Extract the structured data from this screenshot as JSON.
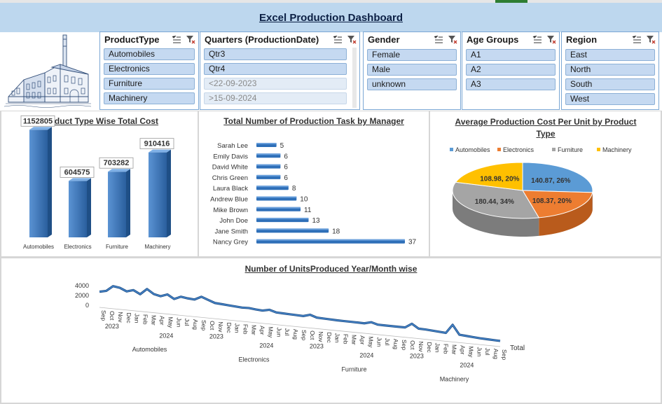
{
  "dashboard_title": "Excel Production Dashboard",
  "slicers": {
    "product_type": {
      "title": "ProductType",
      "items": [
        "Automobiles",
        "Electronics",
        "Furniture",
        "Machinery"
      ]
    },
    "quarters": {
      "title": "Quarters (ProductionDate)",
      "items": [
        "Qtr3",
        "Qtr4"
      ],
      "dim_items": [
        "<22-09-2023",
        ">15-09-2024"
      ]
    },
    "gender": {
      "title": "Gender",
      "items": [
        "Female",
        "Male",
        "unknown"
      ]
    },
    "age_groups": {
      "title": "Age Groups",
      "items": [
        "A1",
        "A2",
        "A3"
      ]
    },
    "region": {
      "title": "Region",
      "items": [
        "East",
        "North",
        "South",
        "West"
      ]
    }
  },
  "charts": {
    "product_cost": {
      "title": "Product Type Wise Total Cost"
    },
    "manager_tasks": {
      "title": "Total Number of Production Task by Manager"
    },
    "avg_cost": {
      "title": "Average Production Cost Per Unit by Product Type"
    },
    "units": {
      "title": "Number of UnitsProduced Year/Month wise",
      "legend": "Total"
    }
  },
  "colors": {
    "bar_blue": "#2e6fb8",
    "header_blue": "#bdd7ee",
    "automobiles": "#5b9bd5",
    "electronics": "#ed7d31",
    "furniture": "#a5a5a5",
    "machinery": "#ffc000"
  },
  "chart_data": [
    {
      "type": "bar",
      "title": "Product Type Wise Total Cost",
      "categories": [
        "Automobiles",
        "Electronics",
        "Furniture",
        "Machinery"
      ],
      "values": [
        1152805,
        604575,
        703282,
        910416
      ],
      "data_labels": [
        "1152805",
        "604575",
        "703282",
        "910416"
      ]
    },
    {
      "type": "bar",
      "orientation": "horizontal",
      "title": "Total Number of Production Task by Manager",
      "categories": [
        "Sarah Lee",
        "Emily Davis",
        "David White",
        "Chris Green",
        "Laura Black",
        "Andrew Blue",
        "Mike Brown",
        "John Doe",
        "Jane Smith",
        "Nancy Grey"
      ],
      "values": [
        5,
        6,
        6,
        6,
        8,
        10,
        11,
        13,
        18,
        37
      ],
      "data_labels": [
        "5",
        "6",
        "6",
        "6",
        "8",
        "10",
        "11",
        "13",
        "18",
        "37"
      ]
    },
    {
      "type": "pie",
      "title": "Average Production Cost Per Unit by Product Type",
      "legend_position": "top",
      "categories": [
        "Automobiles",
        "Electronics",
        "Furniture",
        "Machinery"
      ],
      "values": [
        140.87,
        108.37,
        180.44,
        108.98
      ],
      "data_labels": [
        "140.87, 26%",
        "108.37, 20%",
        "180.44, 34%",
        "108.98, 20%"
      ]
    },
    {
      "type": "line",
      "title": "Number of UnitsProduced Year/Month wise",
      "legend_position": "right",
      "ylim": [
        0,
        4000
      ],
      "y_ticks": [
        "4000",
        "2000",
        "0"
      ],
      "series": [
        {
          "name": "Total",
          "values": [
            1200,
            1500,
            2600,
            2400,
            1800,
            2200,
            1500,
            2700,
            1800,
            1500,
            2000,
            1200,
            1800,
            1600,
            1500,
            2200,
            1700,
            1200,
            1100,
            1000,
            900,
            800,
            850,
            700,
            600,
            900,
            500,
            450,
            400,
            350,
            300,
            700,
            250,
            200,
            150,
            100,
            90,
            80,
            60,
            40,
            400,
            30,
            20,
            10,
            0,
            10,
            900,
            30,
            0,
            -100,
            -200,
            -300,
            1500,
            -400,
            -500,
            -600,
            -700,
            -750,
            -800,
            -850
          ]
        }
      ],
      "x_groups": [
        {
          "product": "Automobiles",
          "years": [
            {
              "year": "2023",
              "months": [
                "Sep",
                "Oct",
                "Nov",
                "Dec"
              ]
            },
            {
              "year": "2024",
              "months": [
                "Jan",
                "Feb",
                "Mar",
                "Apr",
                "May",
                "Jun",
                "Jul",
                "Aug",
                "Sep"
              ]
            }
          ]
        },
        {
          "product": "Electronics",
          "years": [
            {
              "year": "2023",
              "months": [
                "Oct",
                "Nov",
                "Dec"
              ]
            },
            {
              "year": "2024",
              "months": [
                "Jan",
                "Feb",
                "Mar",
                "Apr",
                "May",
                "Jun",
                "Jul",
                "Aug",
                "Sep"
              ]
            }
          ]
        },
        {
          "product": "Furniture",
          "years": [
            {
              "year": "2023",
              "months": [
                "Oct",
                "Nov",
                "Dec"
              ]
            },
            {
              "year": "2024",
              "months": [
                "Jan",
                "Feb",
                "Mar",
                "Apr",
                "May",
                "Jun",
                "Jul",
                "Aug",
                "Sep"
              ]
            }
          ]
        },
        {
          "product": "Machinery",
          "years": [
            {
              "year": "2023",
              "months": [
                "Oct",
                "Nov",
                "Dec"
              ]
            },
            {
              "year": "2024",
              "months": [
                "Jan",
                "Feb",
                "Mar",
                "Apr",
                "May",
                "Jun",
                "Jul",
                "Aug",
                "Sep"
              ]
            }
          ]
        }
      ]
    }
  ]
}
